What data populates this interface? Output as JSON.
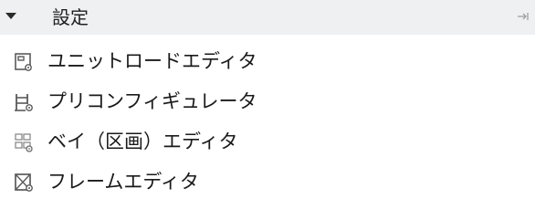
{
  "group": {
    "title": "設定"
  },
  "items": [
    {
      "label": "ユニットロードエディタ",
      "icon": "unit-load-editor-icon"
    },
    {
      "label": "プリコンフィギュレータ",
      "icon": "preconfigurator-icon"
    },
    {
      "label": "ベイ（区画）エディタ",
      "icon": "bay-editor-icon"
    },
    {
      "label": "フレームエディタ",
      "icon": "frame-editor-icon"
    }
  ],
  "colors": {
    "header_bg": "#eef0f2",
    "text": "#1a1a1a",
    "icon": "#5a5a5a"
  }
}
